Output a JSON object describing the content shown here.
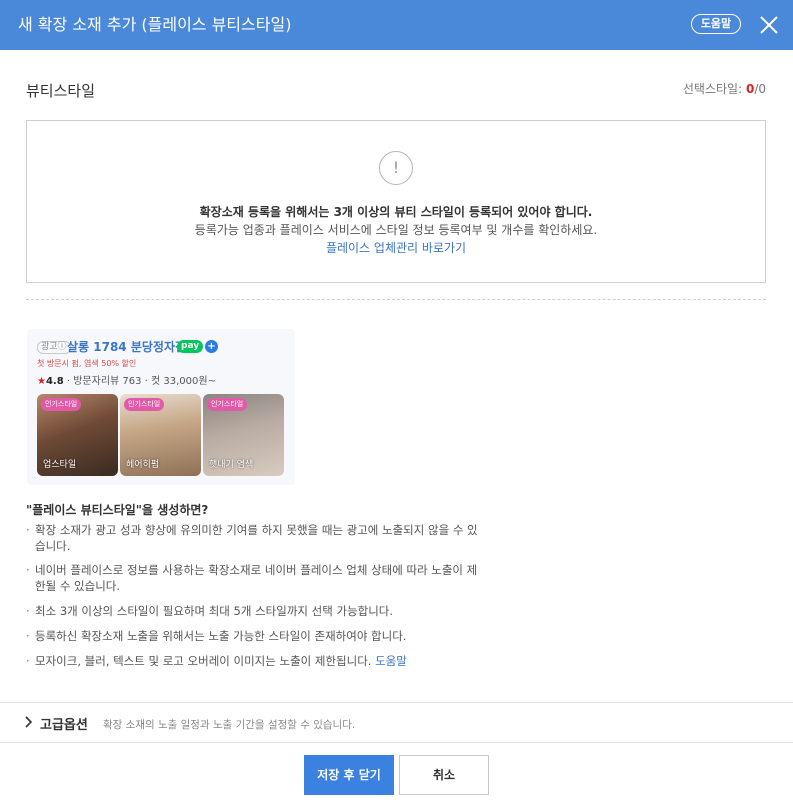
{
  "header": {
    "title": "새 확장 소재 추가 (플레이스 뷰티스타일)",
    "help_label": "도움말"
  },
  "section": {
    "title": "뷰티스타일",
    "select_label": "선택스타일: ",
    "selected": "0",
    "separator": "/",
    "total": "0"
  },
  "notice": {
    "line1": "확장소재 등록을 위해서는 3개 이상의 뷰티 스타일이 등록되어 있어야 합니다.",
    "line2": "등록가능 업종과 플레이스 서비스에 스타일 정보 등록여부 및 개수를 확인하세요.",
    "link": "플레이스 업체관리 바로가기"
  },
  "preview": {
    "ad_badge": "광고ⓘ",
    "shop_name": "살롱 1784 분당정자점",
    "pay_label": "pay",
    "promo": "첫 방문시 펌, 염색 50% 할인",
    "rating": "4.8",
    "meta": " · 방문자리뷰 763 · 컷 33,000원~",
    "styles": [
      {
        "tag": "인기스타일",
        "caption": "업스타일"
      },
      {
        "tag": "인기스타일",
        "caption": "헤어히펌"
      },
      {
        "tag": "인기스타일",
        "caption": "햇내기 염색"
      }
    ]
  },
  "guide": {
    "title": "\"플레이스 뷰티스타일\"을 생성하면?",
    "items": [
      "확장 소재가 광고 성과 향상에 유의미한 기여를 하지 못했을 때는 광고에 노출되지 않을 수 있습니다.",
      "네이버 플레이스로 정보를 사용하는 확장소재로 네이버 플레이스 업체 상태에 따라 노출이 제한될 수 있습니다.",
      "최소 3개 이상의 스타일이 필요하며 최대 5개 스타일까지 선택 가능합니다.",
      "등록하신 확장소재 노출을 위해서는 노출 가능한 스타일이 존재하여야 합니다.",
      "모자이크, 블러, 텍스트 및 로고 오버레이 이미지는 노출이 제한됩니다. "
    ],
    "last_link": "도움말"
  },
  "advanced": {
    "label": "고급옵션",
    "description": "확장 소재의 노출 일정과 노출 기간을 설정할 수 있습니다."
  },
  "footer": {
    "save_label": "저장 후 닫기",
    "cancel_label": "취소"
  },
  "colors": {
    "header_bg": "#4a88d9",
    "primary_button": "#3b82e0",
    "link": "#3b75c8",
    "count_red": "#e02020"
  },
  "icons": [
    "close-icon",
    "exclamation-icon",
    "chevron-right-icon",
    "star-icon",
    "pay-plus-icon"
  ]
}
